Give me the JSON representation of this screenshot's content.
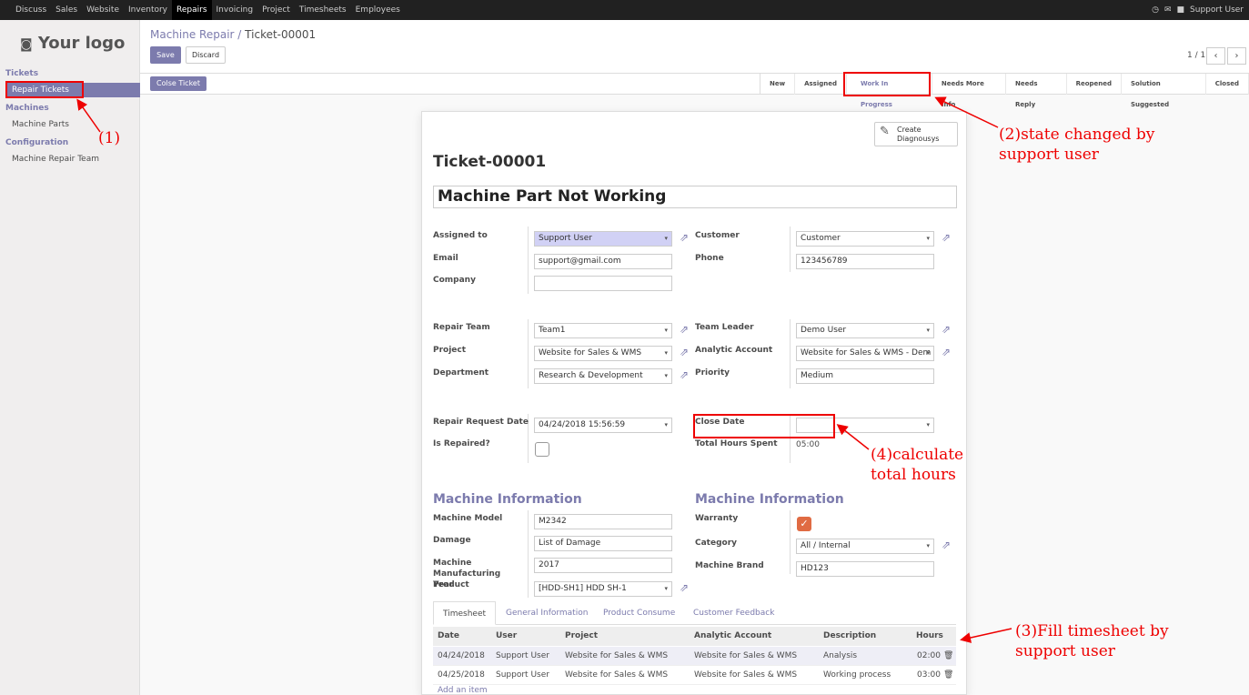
{
  "topbar": {
    "menu": [
      "Discuss",
      "Sales",
      "Website",
      "Inventory",
      "Repairs",
      "Invoicing",
      "Project",
      "Timesheets",
      "Employees"
    ],
    "active": "Repairs",
    "user": "Support User"
  },
  "sidebar": {
    "logo": "Your logo",
    "sections": [
      {
        "title": "Tickets",
        "items": [
          "Repair Tickets"
        ]
      },
      {
        "title": "Machines",
        "items": [
          "Machine Parts"
        ]
      },
      {
        "title": "Configuration",
        "items": [
          "Machine Repair Team"
        ]
      }
    ]
  },
  "breadcrumb": {
    "parent": "Machine Repair",
    "separator": "/",
    "current": "Ticket-00001"
  },
  "buttons": {
    "save": "Save",
    "discard": "Discard",
    "close_ticket": "Colse Ticket",
    "create_diagnosis_line1": "Create",
    "create_diagnosis_line2": "Diagnousys"
  },
  "pager": {
    "text": "1 / 1",
    "prev": "‹",
    "next": "›"
  },
  "states": [
    "New",
    "Assigned",
    "Work In Progress",
    "Needs More Info",
    "Needs Reply",
    "Reopened",
    "Solution Suggested",
    "Closed"
  ],
  "current_state": "Work In Progress",
  "ticket": {
    "number": "Ticket-00001",
    "subject": "Machine Part Not Working",
    "assigned_to_label": "Assigned to",
    "assigned_to": "Support User",
    "email_label": "Email",
    "email": "support@gmail.com",
    "company_label": "Company",
    "company": "",
    "customer_label": "Customer",
    "customer": "Customer",
    "phone_label": "Phone",
    "phone": "123456789",
    "repair_team_label": "Repair Team",
    "repair_team": "Team1",
    "project_label": "Project",
    "project": "Website for Sales & WMS",
    "department_label": "Department",
    "department": "Research & Development",
    "team_leader_label": "Team Leader",
    "team_leader": "Demo User",
    "analytic_account_label": "Analytic Account",
    "analytic_account": "Website for Sales & WMS - Dem",
    "priority_label": "Priority",
    "priority": "Medium",
    "request_date_label": "Repair Request Date",
    "request_date": "04/24/2018 15:56:59",
    "is_repaired_label": "Is Repaired?",
    "close_date_label": "Close Date",
    "close_date": "",
    "total_hours_label": "Total Hours Spent",
    "total_hours": "05:00"
  },
  "machine_left": {
    "title": "Machine Information",
    "model_label": "Machine Model",
    "model": "M2342",
    "damage_label": "Damage",
    "damage": "List of Damage",
    "year_label": "Machine Manufacturing Year",
    "year": "2017",
    "product_label": "Product",
    "product": "[HDD-SH1] HDD SH-1"
  },
  "machine_right": {
    "title": "Machine Information",
    "warranty_label": "Warranty",
    "category_label": "Category",
    "category": "All / Internal",
    "brand_label": "Machine Brand",
    "brand": "HD123"
  },
  "tabs": [
    "Timesheet",
    "General Information",
    "Product Consume",
    "Customer Feedback"
  ],
  "timesheet": {
    "headers": [
      "Date",
      "User",
      "Project",
      "Analytic Account",
      "Description",
      "Hours"
    ],
    "rows": [
      [
        "04/24/2018",
        "Support User",
        "Website for Sales & WMS",
        "Website for Sales & WMS",
        "Analysis",
        "02:00"
      ],
      [
        "04/25/2018",
        "Support User",
        "Website for Sales & WMS",
        "Website for Sales & WMS",
        "Working process",
        "03:00"
      ]
    ],
    "add_item": "Add an item"
  },
  "annotations": {
    "a1": "(1)",
    "a2_line1": "(2)state changed by",
    "a2_line2": "support user",
    "a3_line1": "(3)Fill timesheet by",
    "a3_line2": "support user",
    "a4_line1": "(4)calculate",
    "a4_line2": "total hours"
  },
  "colors": {
    "accent": "#7c7bad",
    "annotation": "#ee0000",
    "topbar": "#212121"
  }
}
